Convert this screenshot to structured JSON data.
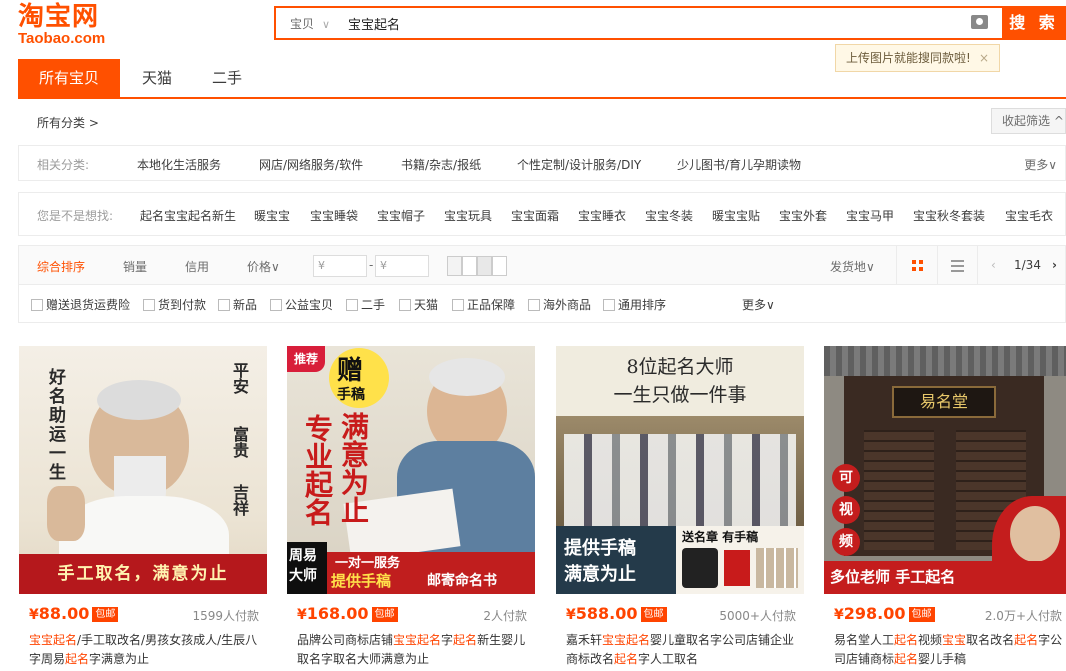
{
  "logo": {
    "cn": "淘宝网",
    "en": "Taobao.com"
  },
  "search": {
    "type": "宝贝",
    "query": "宝宝起名",
    "button": "搜 索"
  },
  "tooltip": {
    "text": "上传图片就能搜同款啦!",
    "close": "×"
  },
  "tabs": [
    "所有宝贝",
    "天猫",
    "二手"
  ],
  "filters": {
    "all_categories": "所有分类 >",
    "collapse": "收起筛选 ^",
    "related_label": "相关分类:",
    "related": [
      "本地化生活服务",
      "网店/网络服务/软件",
      "书籍/杂志/报纸",
      "个性定制/设计服务/DIY",
      "少儿图书/育儿孕期读物"
    ],
    "more": "更多∨",
    "guess_label": "您是不是想找:",
    "guesses": [
      "起名宝宝起名新生",
      "暖宝宝",
      "宝宝睡袋",
      "宝宝帽子",
      "宝宝玩具",
      "宝宝面霜",
      "宝宝睡衣",
      "宝宝冬装",
      "暖宝宝贴",
      "宝宝外套",
      "宝宝马甲",
      "宝宝秋冬套装",
      "宝宝毛衣"
    ]
  },
  "sortbar": {
    "items": [
      "综合排序",
      "销量",
      "信用",
      "价格∨"
    ],
    "price_min": "¥",
    "price_max": "¥",
    "dash": "-",
    "ship_from": "发货地∨",
    "page": "1/34"
  },
  "checkboxes": [
    "赠送退货运费险",
    "货到付款",
    "新品",
    "公益宝贝",
    "二手",
    "天猫",
    "正品保障",
    "海外商品",
    "通用排序"
  ],
  "checkbox_more": "更多∨",
  "products": [
    {
      "price": "88.00",
      "free": "包邮",
      "deals": "1599人付款",
      "title_parts": [
        [
          "宝宝起名",
          true
        ],
        [
          "/手工取改名/男孩女孩成人/生辰八字周易",
          false
        ],
        [
          "起名",
          true
        ],
        [
          "字满意为止",
          false
        ]
      ],
      "img": {
        "left_text": "好名助运一生",
        "right1": "平安",
        "right2": "富贵",
        "right3": "吉祥",
        "bottom": "手工取名，满意为止"
      }
    },
    {
      "price": "168.00",
      "free": "包邮",
      "deals": "2人付款",
      "title_parts": [
        [
          "品牌公司商标店铺",
          false
        ],
        [
          "宝宝起名",
          true
        ],
        [
          "字",
          false
        ],
        [
          "起名",
          true
        ],
        [
          "新生婴儿取名字取名大师满意为止",
          false
        ]
      ],
      "img": {
        "tag": "推荐",
        "gift": "赠",
        "gift2": "手稿",
        "v1": "专业起名",
        "v2": "满意为止",
        "b1": "周易大师",
        "b2": "一对一服务",
        "b3": "提供手稿",
        "b4": "邮寄命名书"
      }
    },
    {
      "price": "588.00",
      "free": "包邮",
      "deals": "5000+人付款",
      "title_parts": [
        [
          "嘉禾轩",
          false
        ],
        [
          "宝宝起名",
          true
        ],
        [
          "婴儿童取名字公司店铺企业商标改名",
          false
        ],
        [
          "起名",
          true
        ],
        [
          "字人工取名",
          false
        ]
      ],
      "img": {
        "line1": "8位起名大师",
        "line2": "一生只做一件事",
        "b1": "提供手稿",
        "b2": "满意为止",
        "b3": "送名章 有手稿"
      }
    },
    {
      "price": "298.00",
      "free": "包邮",
      "deals": "2.0万+人付款",
      "title_parts": [
        [
          "易名堂人工",
          false
        ],
        [
          "起名",
          true
        ],
        [
          "视频",
          false
        ],
        [
          "宝宝",
          true
        ],
        [
          "取名改名",
          false
        ],
        [
          "起名",
          true
        ],
        [
          "字公司店铺商标",
          false
        ],
        [
          "起名",
          true
        ],
        [
          "婴儿手稿",
          false
        ]
      ],
      "img": {
        "sign": "易名堂",
        "c1": "可",
        "c2": "视",
        "c3": "频",
        "bottom": "多位老师 手工起名"
      }
    }
  ],
  "colors": {
    "brand": "#ff5000",
    "price": "#ff4400"
  }
}
